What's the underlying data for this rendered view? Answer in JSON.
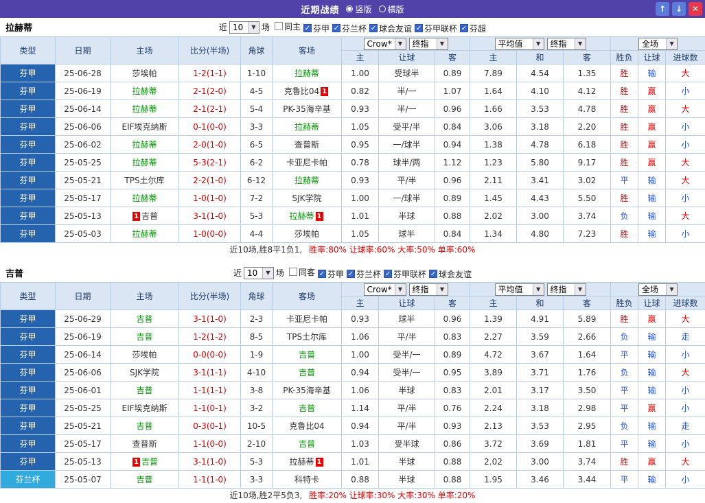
{
  "topbar": {
    "title": "近期战绩",
    "radio_vertical": "竖版",
    "radio_horizontal": "横版",
    "up_icon": "↑",
    "down_icon": "↓",
    "close_icon": "✕"
  },
  "icons": {
    "check": "✓",
    "dropdown_arrow": "▼"
  },
  "colors": {
    "topbar_purple": "#5042a9",
    "league_blue": "#2563ae",
    "cup_blue": "#31aade",
    "focal_green": "#009900",
    "positive_red": "#e60000",
    "negative_blue": "#1f4fd8",
    "score_red": "#d40000"
  },
  "filter_common": {
    "near_label": "近",
    "matches_count": "10",
    "matches_label": "场"
  },
  "table_header": {
    "type": "类型",
    "date": "日期",
    "home": "主场",
    "score": "比分(半场)",
    "corner": "角球",
    "away": "客场",
    "odds_home": "主",
    "odds_handicap": "让球",
    "odds_away": "客",
    "avg_home": "主",
    "avg_draw": "和",
    "avg_away": "客",
    "result_outcome": "胜负",
    "result_handicap": "让球",
    "result_goals": "进球数",
    "dropdown_crow": "Crow*",
    "dropdown_final1": "终指",
    "dropdown_avg": "平均值",
    "dropdown_final2": "终指",
    "dropdown_fulltime": "全场"
  },
  "result_red_values": [
    "胜",
    "赢",
    "大"
  ],
  "sections": [
    {
      "team": "拉赫蒂",
      "filters": [
        {
          "label": "同主",
          "checked": false
        },
        {
          "label": "芬甲",
          "checked": true
        },
        {
          "label": "芬兰杯",
          "checked": true
        },
        {
          "label": "球会友谊",
          "checked": true
        },
        {
          "label": "芬甲联杯",
          "checked": true
        },
        {
          "label": "芬超",
          "checked": true
        }
      ],
      "rows": [
        {
          "league": "芬甲",
          "cup": false,
          "date": "25-06-28",
          "home": "莎埃帕",
          "home_focal": false,
          "home_card": "",
          "score": "1-2(1-1)",
          "corner": "1-10",
          "away": "拉赫蒂",
          "away_focal": true,
          "away_card": "",
          "o1": "1.00",
          "o2": "受球半",
          "o3": "0.89",
          "a1": "7.89",
          "a2": "4.54",
          "a3": "1.35",
          "r1": "胜",
          "r2": "输",
          "r3": "大"
        },
        {
          "league": "芬甲",
          "cup": false,
          "date": "25-06-19",
          "home": "拉赫蒂",
          "home_focal": true,
          "home_card": "",
          "score": "2-1(2-0)",
          "corner": "4-5",
          "away": "克鲁比04",
          "away_focal": false,
          "away_card": "1",
          "o1": "0.82",
          "o2": "半/一",
          "o3": "1.07",
          "a1": "1.64",
          "a2": "4.10",
          "a3": "4.12",
          "r1": "胜",
          "r2": "赢",
          "r3": "小"
        },
        {
          "league": "芬甲",
          "cup": false,
          "date": "25-06-14",
          "home": "拉赫蒂",
          "home_focal": true,
          "home_card": "",
          "score": "2-1(2-1)",
          "corner": "5-4",
          "away": "PK-35海辛基",
          "away_focal": false,
          "away_card": "",
          "o1": "0.93",
          "o2": "半/一",
          "o3": "0.96",
          "a1": "1.66",
          "a2": "3.53",
          "a3": "4.78",
          "r1": "胜",
          "r2": "赢",
          "r3": "大"
        },
        {
          "league": "芬甲",
          "cup": false,
          "date": "25-06-06",
          "home": "EIF埃克纳斯",
          "home_focal": false,
          "home_card": "",
          "score": "0-1(0-0)",
          "corner": "3-3",
          "away": "拉赫蒂",
          "away_focal": true,
          "away_card": "",
          "o1": "1.05",
          "o2": "受平/半",
          "o3": "0.84",
          "a1": "3.06",
          "a2": "3.18",
          "a3": "2.20",
          "r1": "胜",
          "r2": "赢",
          "r3": "小"
        },
        {
          "league": "芬甲",
          "cup": false,
          "date": "25-06-02",
          "home": "拉赫蒂",
          "home_focal": true,
          "home_card": "",
          "score": "2-0(1-0)",
          "corner": "6-5",
          "away": "查普斯",
          "away_focal": false,
          "away_card": "",
          "o1": "0.95",
          "o2": "一/球半",
          "o3": "0.94",
          "a1": "1.38",
          "a2": "4.78",
          "a3": "6.18",
          "r1": "胜",
          "r2": "赢",
          "r3": "小"
        },
        {
          "league": "芬甲",
          "cup": false,
          "date": "25-05-25",
          "home": "拉赫蒂",
          "home_focal": true,
          "home_card": "",
          "score": "5-3(2-1)",
          "corner": "6-2",
          "away": "卡亚尼卡帕",
          "away_focal": false,
          "away_card": "",
          "o1": "0.78",
          "o2": "球半/两",
          "o3": "1.12",
          "a1": "1.23",
          "a2": "5.80",
          "a3": "9.17",
          "r1": "胜",
          "r2": "赢",
          "r3": "大"
        },
        {
          "league": "芬甲",
          "cup": false,
          "date": "25-05-21",
          "home": "TPS土尔库",
          "home_focal": false,
          "home_card": "",
          "score": "2-2(1-0)",
          "corner": "6-12",
          "away": "拉赫蒂",
          "away_focal": true,
          "away_card": "",
          "o1": "0.93",
          "o2": "平/半",
          "o3": "0.96",
          "a1": "2.11",
          "a2": "3.41",
          "a3": "3.02",
          "r1": "平",
          "r2": "输",
          "r3": "大"
        },
        {
          "league": "芬甲",
          "cup": false,
          "date": "25-05-17",
          "home": "拉赫蒂",
          "home_focal": true,
          "home_card": "",
          "score": "1-0(1-0)",
          "corner": "7-2",
          "away": "SJK学院",
          "away_focal": false,
          "away_card": "",
          "o1": "1.00",
          "o2": "一/球半",
          "o3": "0.89",
          "a1": "1.45",
          "a2": "4.43",
          "a3": "5.50",
          "r1": "胜",
          "r2": "输",
          "r3": "小"
        },
        {
          "league": "芬甲",
          "cup": false,
          "date": "25-05-13",
          "home": "吉普",
          "home_focal": false,
          "home_card": "1",
          "score": "3-1(1-0)",
          "corner": "5-3",
          "away": "拉赫蒂",
          "away_focal": true,
          "away_card": "1",
          "o1": "1.01",
          "o2": "半球",
          "o3": "0.88",
          "a1": "2.02",
          "a2": "3.00",
          "a3": "3.74",
          "r1": "负",
          "r2": "输",
          "r3": "大"
        },
        {
          "league": "芬甲",
          "cup": false,
          "date": "25-05-03",
          "home": "拉赫蒂",
          "home_focal": true,
          "home_card": "",
          "score": "1-0(0-0)",
          "corner": "4-4",
          "away": "莎埃帕",
          "away_focal": false,
          "away_card": "",
          "o1": "1.05",
          "o2": "球半",
          "o3": "0.84",
          "a1": "1.34",
          "a2": "4.80",
          "a3": "7.23",
          "r1": "胜",
          "r2": "输",
          "r3": "小"
        }
      ],
      "footer": {
        "summary": "近10场,胜8平1负1,",
        "rates": "胜率:80% 让球率:60% 大率:50% 单率:60%"
      }
    },
    {
      "team": "吉普",
      "filters": [
        {
          "label": "同客",
          "checked": false
        },
        {
          "label": "芬甲",
          "checked": true
        },
        {
          "label": "芬兰杯",
          "checked": true
        },
        {
          "label": "芬甲联杯",
          "checked": true
        },
        {
          "label": "球会友谊",
          "checked": true
        }
      ],
      "rows": [
        {
          "league": "芬甲",
          "cup": false,
          "date": "25-06-29",
          "home": "吉普",
          "home_focal": true,
          "home_card": "",
          "score": "3-1(1-0)",
          "corner": "2-3",
          "away": "卡亚尼卡帕",
          "away_focal": false,
          "away_card": "",
          "o1": "0.93",
          "o2": "球半",
          "o3": "0.96",
          "a1": "1.39",
          "a2": "4.91",
          "a3": "5.89",
          "r1": "胜",
          "r2": "赢",
          "r3": "大"
        },
        {
          "league": "芬甲",
          "cup": false,
          "date": "25-06-19",
          "home": "吉普",
          "home_focal": true,
          "home_card": "",
          "score": "1-2(1-2)",
          "corner": "8-5",
          "away": "TPS土尔库",
          "away_focal": false,
          "away_card": "",
          "o1": "1.06",
          "o2": "平/半",
          "o3": "0.83",
          "a1": "2.27",
          "a2": "3.59",
          "a3": "2.66",
          "r1": "负",
          "r2": "输",
          "r3": "走"
        },
        {
          "league": "芬甲",
          "cup": false,
          "date": "25-06-14",
          "home": "莎埃帕",
          "home_focal": false,
          "home_card": "",
          "score": "0-0(0-0)",
          "corner": "1-9",
          "away": "吉普",
          "away_focal": true,
          "away_card": "",
          "o1": "1.00",
          "o2": "受半/一",
          "o3": "0.89",
          "a1": "4.72",
          "a2": "3.67",
          "a3": "1.64",
          "r1": "平",
          "r2": "输",
          "r3": "小"
        },
        {
          "league": "芬甲",
          "cup": false,
          "date": "25-06-06",
          "home": "SJK学院",
          "home_focal": false,
          "home_card": "",
          "score": "3-1(1-1)",
          "corner": "4-10",
          "away": "吉普",
          "away_focal": true,
          "away_card": "",
          "o1": "0.94",
          "o2": "受半/一",
          "o3": "0.95",
          "a1": "3.89",
          "a2": "3.71",
          "a3": "1.76",
          "r1": "负",
          "r2": "输",
          "r3": "大"
        },
        {
          "league": "芬甲",
          "cup": false,
          "date": "25-06-01",
          "home": "吉普",
          "home_focal": true,
          "home_card": "",
          "score": "1-1(1-1)",
          "corner": "3-8",
          "away": "PK-35海辛基",
          "away_focal": false,
          "away_card": "",
          "o1": "1.06",
          "o2": "半球",
          "o3": "0.83",
          "a1": "2.01",
          "a2": "3.17",
          "a3": "3.50",
          "r1": "平",
          "r2": "输",
          "r3": "小"
        },
        {
          "league": "芬甲",
          "cup": false,
          "date": "25-05-25",
          "home": "EIF埃克纳斯",
          "home_focal": false,
          "home_card": "",
          "score": "1-1(0-1)",
          "corner": "3-2",
          "away": "吉普",
          "away_focal": true,
          "away_card": "",
          "o1": "1.14",
          "o2": "平/半",
          "o3": "0.76",
          "a1": "2.24",
          "a2": "3.18",
          "a3": "2.98",
          "r1": "平",
          "r2": "赢",
          "r3": "小"
        },
        {
          "league": "芬甲",
          "cup": false,
          "date": "25-05-21",
          "home": "吉普",
          "home_focal": true,
          "home_card": "",
          "score": "0-3(0-1)",
          "corner": "10-5",
          "away": "克鲁比04",
          "away_focal": false,
          "away_card": "",
          "o1": "0.94",
          "o2": "平/半",
          "o3": "0.93",
          "a1": "2.13",
          "a2": "3.53",
          "a3": "2.95",
          "r1": "负",
          "r2": "输",
          "r3": "走"
        },
        {
          "league": "芬甲",
          "cup": false,
          "date": "25-05-17",
          "home": "查普斯",
          "home_focal": false,
          "home_card": "",
          "score": "1-1(0-0)",
          "corner": "2-10",
          "away": "吉普",
          "away_focal": true,
          "away_card": "",
          "o1": "1.03",
          "o2": "受半球",
          "o3": "0.86",
          "a1": "3.72",
          "a2": "3.69",
          "a3": "1.81",
          "r1": "平",
          "r2": "输",
          "r3": "小"
        },
        {
          "league": "芬甲",
          "cup": false,
          "date": "25-05-13",
          "home": "吉普",
          "home_focal": true,
          "home_card": "1",
          "score": "3-1(1-0)",
          "corner": "5-3",
          "away": "拉赫蒂",
          "away_focal": false,
          "away_card": "1",
          "o1": "1.01",
          "o2": "半球",
          "o3": "0.88",
          "a1": "2.02",
          "a2": "3.00",
          "a3": "3.74",
          "r1": "胜",
          "r2": "赢",
          "r3": "大"
        },
        {
          "league": "芬兰杯",
          "cup": true,
          "date": "25-05-07",
          "home": "吉普",
          "home_focal": true,
          "home_card": "",
          "score": "1-1(1-0)",
          "corner": "3-3",
          "away": "科特卡",
          "away_focal": false,
          "away_card": "",
          "o1": "0.88",
          "o2": "半球",
          "o3": "0.88",
          "a1": "1.95",
          "a2": "3.46",
          "a3": "3.44",
          "r1": "平",
          "r2": "输",
          "r3": "小"
        }
      ],
      "footer": {
        "summary": "近10场,胜2平5负3,",
        "rates": "胜率:20% 让球率:30% 大率:30% 单率:20%"
      }
    }
  ]
}
